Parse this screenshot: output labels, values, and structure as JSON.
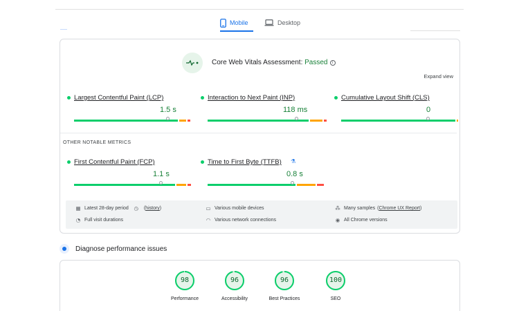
{
  "tabs": [
    {
      "label": "Mobile",
      "active": true,
      "icon": "phone-icon"
    },
    {
      "label": "Desktop",
      "active": false,
      "icon": "laptop-icon"
    }
  ],
  "cwv": {
    "title_prefix": "Core Web Vitals Assessment: ",
    "status": "Passed",
    "expand_label": "Expand view"
  },
  "metrics": [
    {
      "label": "Largest Contentful Paint (LCP)",
      "value": "1.5 s"
    },
    {
      "label": "Interaction to Next Paint (INP)",
      "value": "118 ms"
    },
    {
      "label": "Cumulative Layout Shift (CLS)",
      "value": "0"
    }
  ],
  "other_title": "OTHER NOTABLE METRICS",
  "other_metrics": [
    {
      "label": "First Contentful Paint (FCP)",
      "value": "1.1 s"
    },
    {
      "label": "Time to First Byte (TTFB)",
      "value": "0.8 s"
    }
  ],
  "footer": {
    "period": "Latest 28-day period",
    "history": "history",
    "durations": "Full visit durations",
    "devices": "Various mobile devices",
    "connections": "Various network connections",
    "samples": "Many samples",
    "ux_report": "Chrome UX Report",
    "versions": "All Chrome versions"
  },
  "diagnose": {
    "label": "Diagnose performance issues"
  },
  "scores": [
    {
      "value": "98",
      "label": "Performance"
    },
    {
      "value": "96",
      "label": "Accessibility"
    },
    {
      "value": "96",
      "label": "Best Practices"
    },
    {
      "value": "100",
      "label": "SEO"
    }
  ],
  "colors": {
    "good": "#0cce6b",
    "average": "#ffa400",
    "poor": "#ff4e42",
    "accent": "#1a73e8",
    "pass_text": "#188038"
  }
}
